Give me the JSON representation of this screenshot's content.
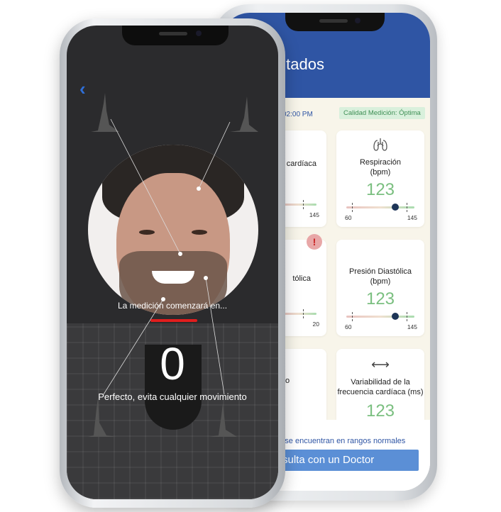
{
  "results_screen": {
    "title": "ultados",
    "measurement_time": "02:00 PM",
    "quality_badge": "Calidad Medición: Óptima",
    "cards": [
      {
        "label": "cardíaca",
        "value": "",
        "range_min": "",
        "range_max": "145"
      },
      {
        "label": "Respiración\n(bpm)",
        "value": "123",
        "range_min": "60",
        "range_max": "145",
        "icon": "lungs-icon"
      },
      {
        "label": "tólica",
        "value": "",
        "range_min": "",
        "range_max": "20"
      },
      {
        "label": "Presión Diastólica\n(bpm)",
        "value": "123",
        "range_min": "60",
        "range_max": "145"
      },
      {
        "label": "abajo\no",
        "value": ""
      },
      {
        "label": "Variabilidad de la\nfrecuencia cardíaca (ms)",
        "value": "123",
        "icon": "left-right-arrow-icon"
      }
    ],
    "alert_badge": "!",
    "footer_note": "no se encuentran en rangos normales",
    "doctor_button": "sulta con un Doctor"
  },
  "scan_screen": {
    "back_icon": "chevron-left-icon",
    "measure_label": "La medición comenzará en...",
    "counter": "0",
    "instruction": "Perfecto, evita cualquier movimiento"
  },
  "colors": {
    "header_blue": "#2f55a4",
    "value_green": "#7bbf80",
    "progress_red": "#e11d1d",
    "button_blue": "#5b8fd6"
  }
}
